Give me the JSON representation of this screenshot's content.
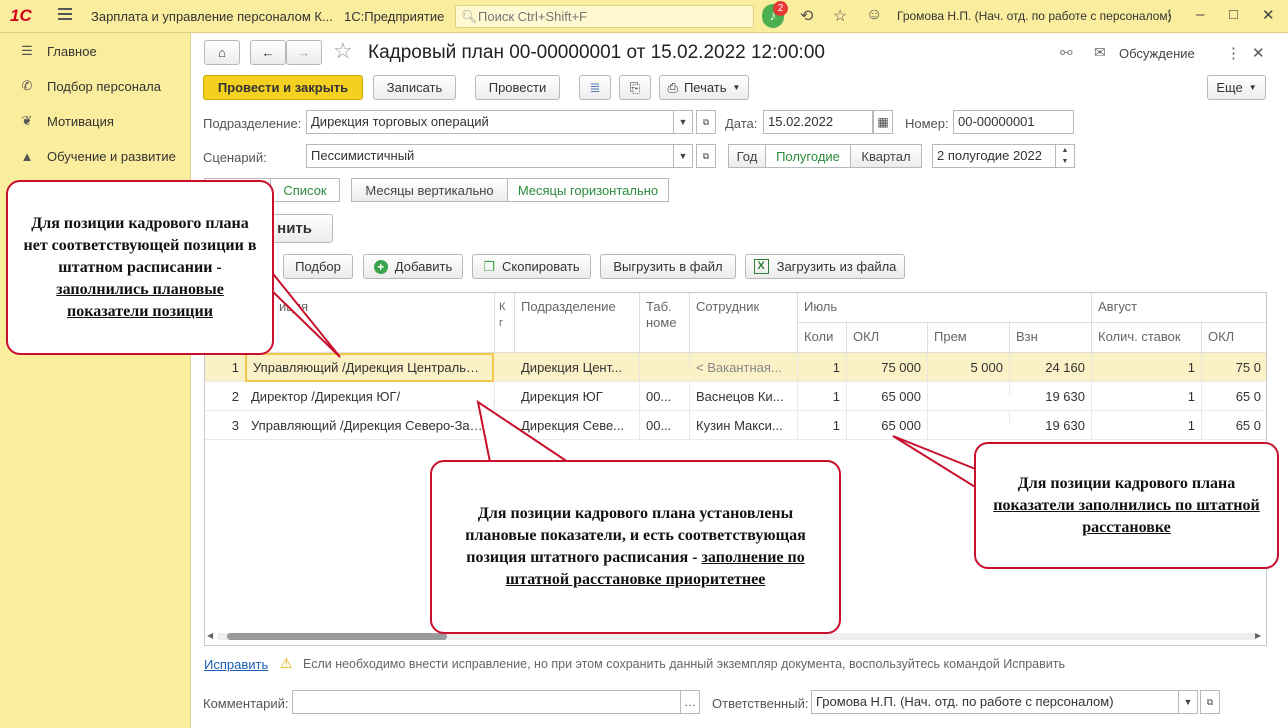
{
  "topbar": {
    "logo": "1С",
    "app_title": "Зарплата и управление персоналом К...",
    "platform": "1С:Предприятие",
    "search_placeholder": "Поиск Ctrl+Shift+F",
    "notifications_count": "2",
    "user": "Громова Н.П. (Нач. отд. по работе с персоналом)"
  },
  "sidebar": {
    "items": [
      {
        "label": "Главное",
        "icon": "menu-icon"
      },
      {
        "label": "Подбор персонала",
        "icon": "phone-icon"
      },
      {
        "label": "Мотивация",
        "icon": "gift-icon"
      },
      {
        "label": "Обучение и развитие",
        "icon": "graduation-cap-icon"
      }
    ]
  },
  "document": {
    "title": "Кадровый план 00-00000001 от 15.02.2022 12:00:00",
    "discussion": "Обсуждение"
  },
  "toolbar": {
    "post_and_close": "Провести и закрыть",
    "save": "Записать",
    "post": "Провести",
    "print": "Печать",
    "more": "Еще"
  },
  "form": {
    "department_label": "Подразделение:",
    "department_value": "Дирекция торговых операций",
    "date_label": "Дата:",
    "date_value": "15.02.2022",
    "number_label": "Номер:",
    "number_value": "00-00000001",
    "scenario_label": "Сценарий:",
    "scenario_value": "Пессимистичный",
    "period_year": "Год",
    "period_half": "Полугодие",
    "period_quarter": "Квартал",
    "period_value": "2 полугодие 2022"
  },
  "views": {
    "list": "Список",
    "months_vertical": "Месяцы вертикально",
    "months_horizontal": "Месяцы горизонтально",
    "fill_partial": "нить"
  },
  "table_toolbar": {
    "select": "Подбор",
    "add": "Добавить",
    "copy": "Скопировать",
    "export": "Выгрузить в файл",
    "import": "Загрузить из файла"
  },
  "table": {
    "headers": {
      "position": "иция",
      "k": "К г",
      "department": "Подразделение",
      "tab_num": "Таб. номе",
      "employee": "Сотрудник",
      "july": "Июль",
      "july_count": "Коли",
      "july_okl": "ОКЛ",
      "july_prem": "Прем",
      "july_vzn": "Взн",
      "august": "Август",
      "aug_count": "Колич. ставок",
      "aug_okl": "ОКЛ"
    },
    "rows": [
      {
        "n": "1",
        "position": "Управляющий /Дирекция Центральны...",
        "department": "Дирекция Цент...",
        "tab": "",
        "employee": "< Вакантная...",
        "count": "1",
        "okl": "75 000",
        "prem": "5 000",
        "vzn": "24 160",
        "aug_count": "1",
        "aug_okl": "75 0"
      },
      {
        "n": "2",
        "position": "Директор /Дирекция ЮГ/",
        "department": "Дирекция ЮГ",
        "tab": "00...",
        "employee": "Васнецов Ки...",
        "count": "1",
        "okl": "65 000",
        "prem": "",
        "vzn": "19 630",
        "aug_count": "1",
        "aug_okl": "65 0"
      },
      {
        "n": "3",
        "position": "Управляющий /Дирекция Северо-Запад/",
        "department": "Дирекция Севе...",
        "tab": "00...",
        "employee": "Кузин Макси...",
        "count": "1",
        "okl": "65 000",
        "prem": "",
        "vzn": "19 630",
        "aug_count": "1",
        "aug_okl": "65 0"
      }
    ]
  },
  "footer": {
    "fix_link": "Исправить",
    "fix_hint": "Если необходимо внести исправление, но при этом сохранить данный экземпляр документа, воспользуйтесь командой Исправить",
    "comment_label": "Комментарий:",
    "comment_value": "",
    "responsible_label": "Ответственный:",
    "responsible_value": "Громова Н.П. (Нач. отд. по работе с персоналом)"
  },
  "callouts": {
    "left_text": "Для позиции кадрового плана нет соответствующей позиции в штатном расписании - ",
    "left_underlined": "заполнились плановые показатели позиции",
    "middle_text": "Для позиции кадрового плана установлены плановые показатели, и есть соответствующая позиция штатного расписания - ",
    "middle_underlined": "заполнение по штатной расстановке приоритетнее",
    "right_text": "Для позиции кадрового плана ",
    "right_underlined": "показатели заполнились по штатной расстановке"
  },
  "colors": {
    "accent_yellow": "#f4d020",
    "topbar": "#fbed9e",
    "callout_border": "#c8102e",
    "selected_row": "#fbf1c7"
  }
}
